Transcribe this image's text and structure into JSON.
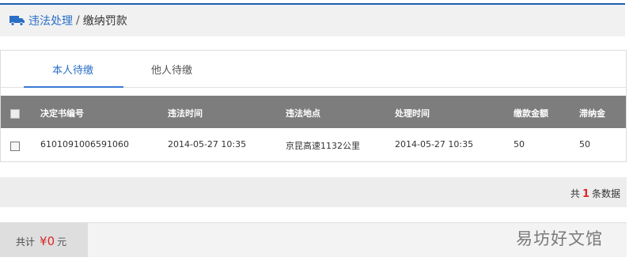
{
  "breadcrumb": {
    "link": "违法处理",
    "separator": "/",
    "current": "缴纳罚款"
  },
  "tabs": [
    {
      "label": "本人待缴"
    },
    {
      "label": "他人待缴"
    }
  ],
  "table": {
    "headers": [
      "决定书编号",
      "违法时间",
      "违法地点",
      "处理时间",
      "缴款金额",
      "滞纳金"
    ],
    "rows": [
      [
        "6101091006591060",
        "2014-05-27 10:35",
        "京昆高速1132公里",
        "2014-05-27 10:35",
        "50",
        "50"
      ]
    ]
  },
  "count": {
    "prefix": "共",
    "value": "1",
    "suffix": "条数据"
  },
  "total": {
    "label": "共计",
    "currency": "¥",
    "amount": "0",
    "unit": "元"
  },
  "watermark": "易坊好文馆",
  "colors": {
    "accent": "#2a6fc6",
    "header_bg": "#7d7d7d",
    "highlight": "#d8282a"
  }
}
